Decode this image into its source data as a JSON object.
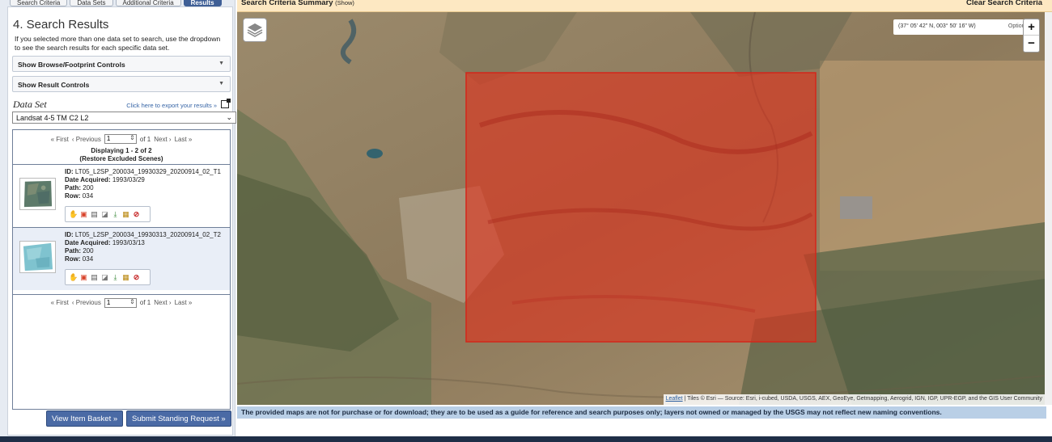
{
  "tabs": [
    {
      "label": "Search Criteria"
    },
    {
      "label": "Data Sets"
    },
    {
      "label": "Additional Criteria"
    },
    {
      "label": "Results"
    }
  ],
  "results_panel": {
    "title": "4. Search Results",
    "description": "If you selected more than one data set to search, use the dropdown to see the search results for each specific data set.",
    "browse_controls_label": "Show Browse/Footprint Controls",
    "result_controls_label": "Show Result Controls",
    "data_set_label": "Data Set",
    "export_link": "Click here to export your results »",
    "selected_data_set": "Landsat 4-5 TM C2 L2",
    "pager": {
      "first": "« First",
      "previous": "‹ Previous",
      "page": "1",
      "of": "of 1",
      "next": "Next ›",
      "last": "Last »"
    },
    "display_info": "Displaying 1 - 2 of 2",
    "restore_link": "(Restore Excluded Scenes)",
    "items": [
      {
        "id_label": "ID:",
        "id": "LT05_L2SP_200034_19930329_20200914_02_T1",
        "date_label": "Date Acquired:",
        "date": "1993/03/29",
        "path_label": "Path:",
        "path": "200",
        "row_label": "Row:",
        "row": "034",
        "thumb_color": "#5d7a6a"
      },
      {
        "id_label": "ID:",
        "id": "LT05_L2SP_200034_19930313_20200914_02_T2",
        "date_label": "Date Acquired:",
        "date": "1993/03/13",
        "path_label": "Path:",
        "path": "200",
        "row_label": "Row:",
        "row": "034",
        "thumb_color": "#7fc3cf"
      }
    ],
    "buttons": {
      "view_basket": "View Item Basket »",
      "submit_request": "Submit Standing Request »"
    }
  },
  "topbar": {
    "summary": "Search Criteria Summary",
    "summary_toggle": "(Show)",
    "clear": "Clear Search Criteria"
  },
  "map": {
    "coordinates": "(37° 05' 42\" N, 003° 50' 16\" W)",
    "options": "Options",
    "zoom_in": "+",
    "zoom_out": "−",
    "attribution_link": "Leaflet",
    "attribution": "| Tiles © Esri — Source: Esri, i-cubed, USDA, USGS, AEX, GeoEye, Getmapping, Aerogrid, IGN, IGP, UPR-EGP, and the GIS User Community",
    "footprint_color": "#e0301c"
  },
  "disclaimer": "The provided maps are not for purchase or for download; they are to be used as a guide for reference and search purposes only; layers not owned or managed by the USGS may not reflect new naming conventions."
}
